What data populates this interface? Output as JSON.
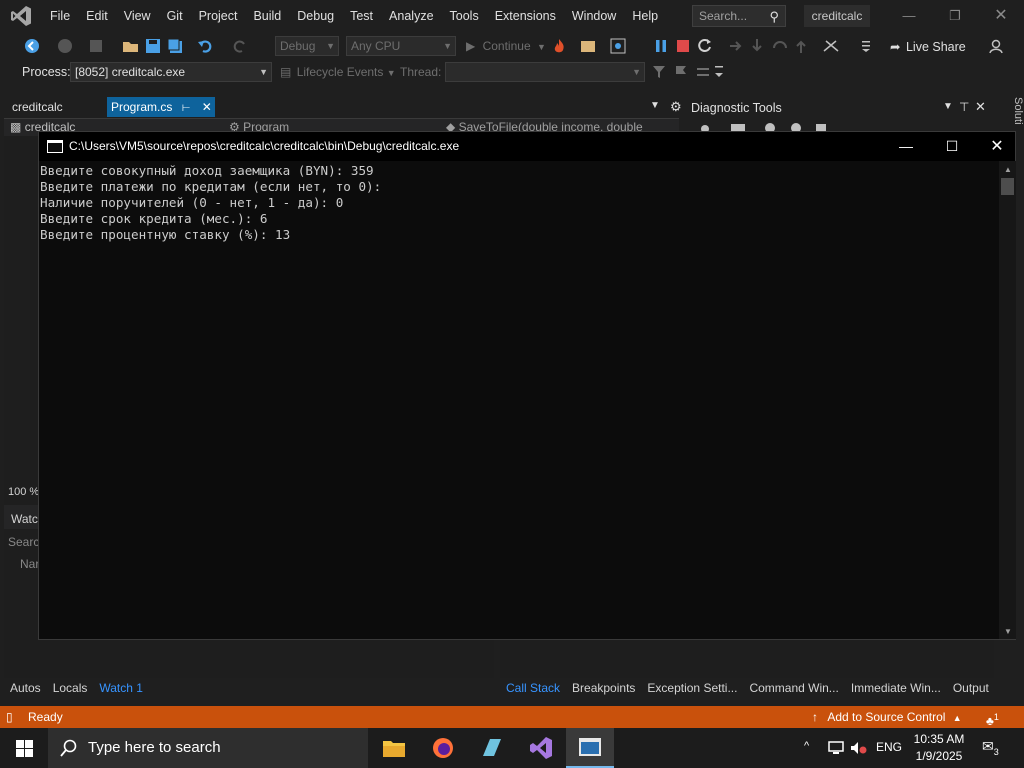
{
  "menu": {
    "items": [
      "File",
      "Edit",
      "View",
      "Git",
      "Project",
      "Build",
      "Debug",
      "Test",
      "Analyze",
      "Tools",
      "Extensions",
      "Window",
      "Help"
    ],
    "search_placeholder": "Search...",
    "solution_name": "creditcalc"
  },
  "toolbar": {
    "config": "Debug",
    "platform": "Any CPU",
    "continue_label": "Continue",
    "live_share": "Live Share"
  },
  "process_bar": {
    "process_label": "Process:",
    "process_value": "[8052] creditcalc.exe",
    "lifecycle_label": "Lifecycle Events",
    "thread_label": "Thread:"
  },
  "tabs": {
    "project": "creditcalc",
    "active_file": "Program.cs",
    "nav_project": "creditcalc",
    "nav_class": "Program",
    "nav_member": "SaveToFile(double income, double"
  },
  "diagnostic_tools": {
    "title": "Diagnostic Tools",
    "side_label": "Soluti"
  },
  "side_panel": {
    "zoom": "100 %",
    "watch_title": "Watc",
    "search": "Searc",
    "name_col": "Nar"
  },
  "console": {
    "title": "C:\\Users\\VM5\\source\\repos\\creditcalc\\creditcalc\\bin\\Debug\\creditcalc.exe",
    "lines": [
      "Введите совокупный доход заемщика (BYN): 359",
      "Введите платежи по кредитам (если нет, то 0):",
      "Наличие поручителей (0 - нет, 1 - да): 0",
      "Введите срок кредита (мес.): 6",
      "Введите процентную ставку (%): 13"
    ]
  },
  "bottom_tabs_left": [
    "Autos",
    "Locals",
    "Watch 1"
  ],
  "bottom_tabs_right": [
    "Call Stack",
    "Breakpoints",
    "Exception Setti...",
    "Command Win...",
    "Immediate Win...",
    "Output"
  ],
  "status": {
    "ready": "Ready",
    "source_control": "Add to Source Control",
    "notifications": "1"
  },
  "taskbar": {
    "search_placeholder": "Type here to search",
    "language": "ENG",
    "time": "10:35 AM",
    "date": "1/9/2025",
    "notification_count": "3"
  },
  "colors": {
    "status_bar": "#c9510c",
    "active_tab": "#0e639c",
    "accent_link": "#3794ff",
    "console_bg": "#0c0c0c"
  }
}
